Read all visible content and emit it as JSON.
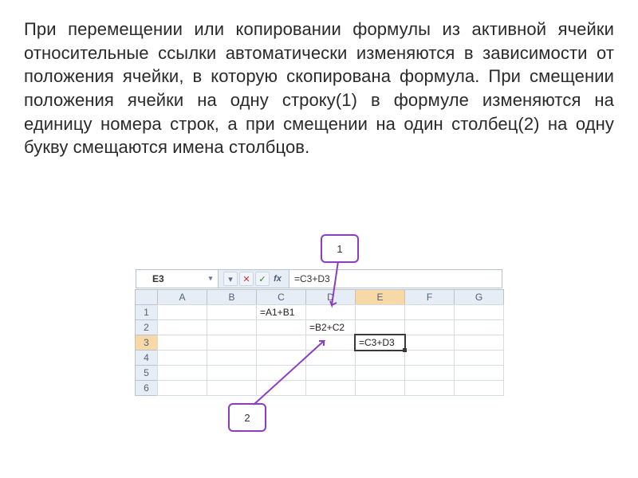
{
  "paragraph": "При перемещении или копировании формулы из активной ячейки относительные ссылки автоматически изменяются в зависимости от положения ячейки, в которую скопирована формула. При смещении положения ячейки на одну строку(1) в формуле изменяются на единицу номера строк, а при смещении на один столбец(2) на одну букву смещаются имена столбцов.",
  "callouts": {
    "one": "1",
    "two": "2"
  },
  "excel": {
    "name_box": "E3",
    "formula_bar": "=C3+D3",
    "fx_buttons": {
      "expand": "▾",
      "cancel": "✕",
      "enter": "✓",
      "fx": "fx"
    },
    "col_headers": [
      "A",
      "B",
      "C",
      "D",
      "E",
      "F",
      "G"
    ],
    "row_headers": [
      "1",
      "2",
      "3",
      "4",
      "5",
      "6"
    ],
    "cells": {
      "C1": "=A1+B1",
      "D2": "=B2+C2",
      "E3": "=C3+D3"
    },
    "active_cell": "E3",
    "sel_col_idx": 4,
    "sel_row_idx": 2
  }
}
